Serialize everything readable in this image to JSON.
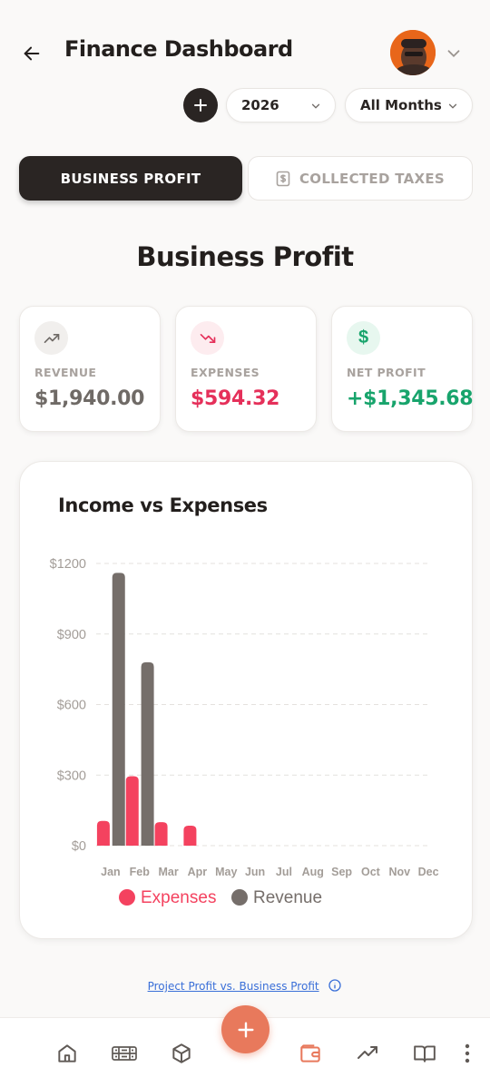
{
  "header": {
    "title": "Finance Dashboard"
  },
  "filters": {
    "year": "2026",
    "month": "All Months"
  },
  "tabs": [
    {
      "label": "BUSINESS PROFIT",
      "active": true
    },
    {
      "label": "COLLECTED TAXES",
      "active": false
    }
  ],
  "section_title": "Business Profit",
  "stats": [
    {
      "label": "REVENUE",
      "value": "$1,940.00",
      "icon": "trending-up-icon",
      "color": "#6f6a66",
      "icon_bg": "#f1efed"
    },
    {
      "label": "EXPENSES",
      "value": "$594.32",
      "icon": "trending-down-icon",
      "color": "#e5305a",
      "icon_bg": "#fdecef"
    },
    {
      "label": "NET PROFIT",
      "value": "+$1,345.68",
      "icon": "dollar-icon",
      "color": "#18a46c",
      "icon_bg": "#e7f7ef"
    }
  ],
  "chart_title": "Income vs Expenses",
  "chart_data": {
    "type": "bar",
    "categories": [
      "Jan",
      "Feb",
      "Mar",
      "Apr",
      "May",
      "Jun",
      "Jul",
      "Aug",
      "Sep",
      "Oct",
      "Nov",
      "Dec"
    ],
    "series": [
      {
        "name": "Expenses",
        "color": "#f4425f",
        "values": [
          105,
          295,
          100,
          85,
          0,
          0,
          0,
          0,
          0,
          0,
          0,
          0
        ]
      },
      {
        "name": "Revenue",
        "color": "#756e6a",
        "values": [
          0,
          1160,
          0,
          0,
          0,
          0,
          0,
          0,
          0,
          0,
          0,
          0
        ]
      },
      {
        "name": "Revenue",
        "color": "#756e6a",
        "values": [
          0,
          0,
          780,
          0,
          0,
          0,
          0,
          0,
          0,
          0,
          0,
          0
        ]
      }
    ],
    "y_ticks": [
      "$0",
      "$300",
      "$600",
      "$900",
      "$1200"
    ],
    "ylim": [
      0,
      1200
    ],
    "grid": true,
    "legend": "bottom",
    "legend_items": [
      {
        "name": "Expenses",
        "color": "#f4425f"
      },
      {
        "name": "Revenue",
        "color": "#756e6a"
      }
    ]
  },
  "footer_link": "Project Profit vs. Business Profit",
  "bottom_nav": [
    "home-icon",
    "inventory-icon",
    "package-icon",
    "wallet-icon",
    "trending-icon",
    "book-icon",
    "more-icon"
  ],
  "colors": {
    "accent": "#e8795c",
    "dark": "#2a2523"
  }
}
